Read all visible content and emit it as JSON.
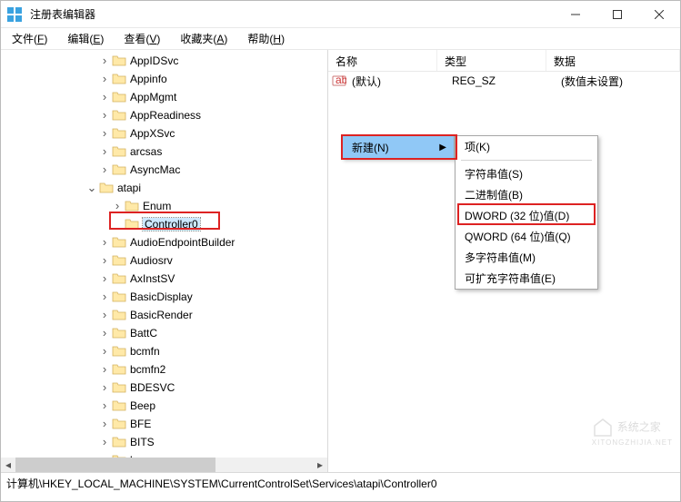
{
  "window": {
    "title": "注册表编辑器",
    "controls": {
      "min": "minimize",
      "max": "maximize",
      "close": "close"
    }
  },
  "menubar": [
    {
      "label": "文件",
      "hotkey": "F"
    },
    {
      "label": "编辑",
      "hotkey": "E"
    },
    {
      "label": "查看",
      "hotkey": "V"
    },
    {
      "label": "收藏夹",
      "hotkey": "A"
    },
    {
      "label": "帮助",
      "hotkey": "H"
    }
  ],
  "tree": {
    "items": [
      {
        "indent": 108,
        "expander": ">",
        "label": "AppIDSvc"
      },
      {
        "indent": 108,
        "expander": ">",
        "label": "Appinfo"
      },
      {
        "indent": 108,
        "expander": ">",
        "label": "AppMgmt"
      },
      {
        "indent": 108,
        "expander": ">",
        "label": "AppReadiness"
      },
      {
        "indent": 108,
        "expander": ">",
        "label": "AppXSvc"
      },
      {
        "indent": 108,
        "expander": ">",
        "label": "arcsas"
      },
      {
        "indent": 108,
        "expander": ">",
        "label": "AsyncMac"
      },
      {
        "indent": 94,
        "expander": "v",
        "label": "atapi"
      },
      {
        "indent": 122,
        "expander": ">",
        "label": "Enum"
      },
      {
        "indent": 122,
        "expander": "",
        "label": "Controller0",
        "selected": true
      },
      {
        "indent": 108,
        "expander": ">",
        "label": "AudioEndpointBuilder"
      },
      {
        "indent": 108,
        "expander": ">",
        "label": "Audiosrv"
      },
      {
        "indent": 108,
        "expander": ">",
        "label": "AxInstSV"
      },
      {
        "indent": 108,
        "expander": ">",
        "label": "BasicDisplay"
      },
      {
        "indent": 108,
        "expander": ">",
        "label": "BasicRender"
      },
      {
        "indent": 108,
        "expander": ">",
        "label": "BattC"
      },
      {
        "indent": 108,
        "expander": ">",
        "label": "bcmfn"
      },
      {
        "indent": 108,
        "expander": ">",
        "label": "bcmfn2"
      },
      {
        "indent": 108,
        "expander": ">",
        "label": "BDESVC"
      },
      {
        "indent": 108,
        "expander": ">",
        "label": "Beep"
      },
      {
        "indent": 108,
        "expander": ">",
        "label": "BFE"
      },
      {
        "indent": 108,
        "expander": ">",
        "label": "BITS"
      },
      {
        "indent": 108,
        "expander": ">",
        "label": "bowser"
      }
    ]
  },
  "list": {
    "columns": {
      "name": "名称",
      "type": "类型",
      "data": "数据"
    },
    "rows": [
      {
        "name": "(默认)",
        "type": "REG_SZ",
        "data": "(数值未设置)"
      }
    ]
  },
  "context": {
    "parent": {
      "label": "新建(N)"
    },
    "items": [
      {
        "label": "项(K)",
        "sep_after": true
      },
      {
        "label": "字符串值(S)"
      },
      {
        "label": "二进制值(B)"
      },
      {
        "label": "DWORD (32 位)值(D)",
        "highlighted": true
      },
      {
        "label": "QWORD (64 位)值(Q)"
      },
      {
        "label": "多字符串值(M)"
      },
      {
        "label": "可扩充字符串值(E)"
      }
    ]
  },
  "statusbar": {
    "path": "计算机\\HKEY_LOCAL_MACHINE\\SYSTEM\\CurrentControlSet\\Services\\atapi\\Controller0"
  },
  "watermark": {
    "text": "系统之家",
    "sub": "XITONGZHIJIA.NET"
  },
  "colors": {
    "highlight_border": "#d22",
    "menu_hover": "#90c8f6",
    "tree_selection": "#cce8ff"
  }
}
